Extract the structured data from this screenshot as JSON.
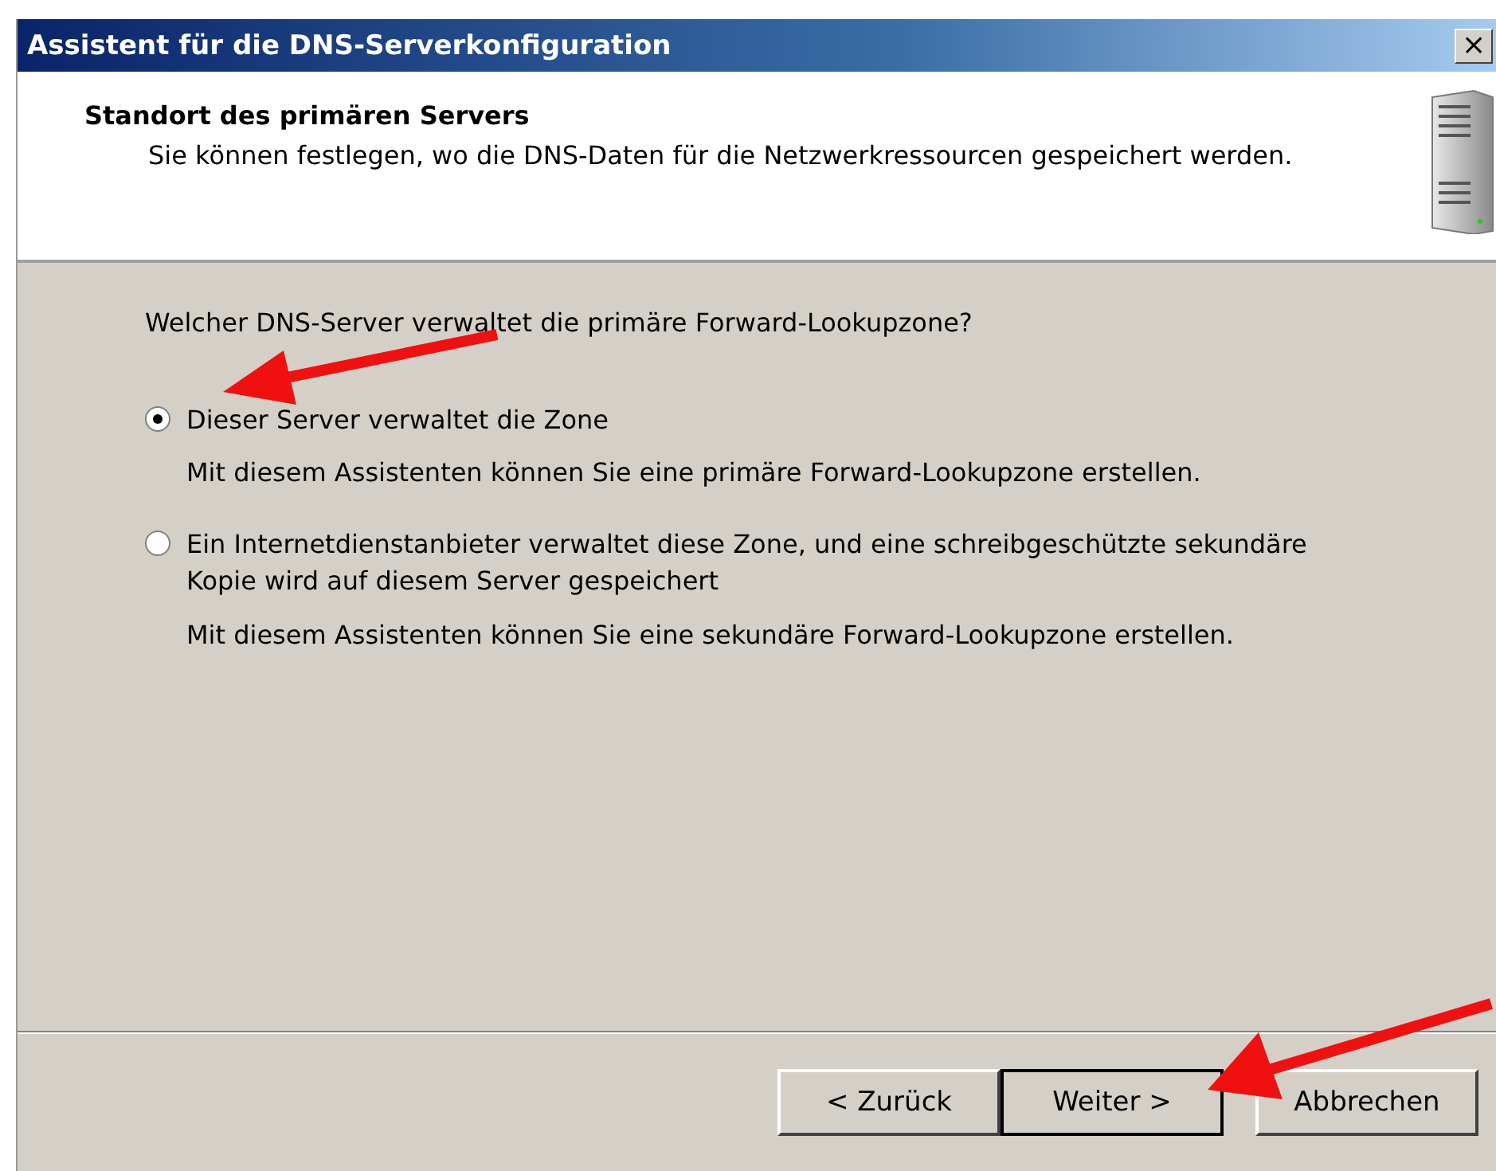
{
  "window": {
    "title": "Assistent für die DNS-Serverkonfiguration",
    "close": "×"
  },
  "header": {
    "title": "Standort des primären Servers",
    "description": "Sie können festlegen, wo die DNS-Daten für die Netzwerkressourcen gespeichert werden."
  },
  "question": "Welcher DNS-Server verwaltet die primäre Forward-Lookupzone?",
  "options": [
    {
      "label": "Dieser Server verwaltet die Zone",
      "description": "Mit diesem Assistenten können Sie eine primäre Forward-Lookupzone erstellen.",
      "selected": true
    },
    {
      "label": "Ein Internetdienstanbieter verwaltet diese Zone, und eine schreibgeschützte sekundäre Kopie wird auf diesem Server gespeichert",
      "description": "Mit diesem Assistenten können Sie eine sekundäre Forward-Lookupzone erstellen.",
      "selected": false
    }
  ],
  "buttons": [
    {
      "label": "< Zurück",
      "default": false
    },
    {
      "label": "Weiter >",
      "default": true
    },
    {
      "label": "Abbrechen",
      "default": false
    }
  ]
}
